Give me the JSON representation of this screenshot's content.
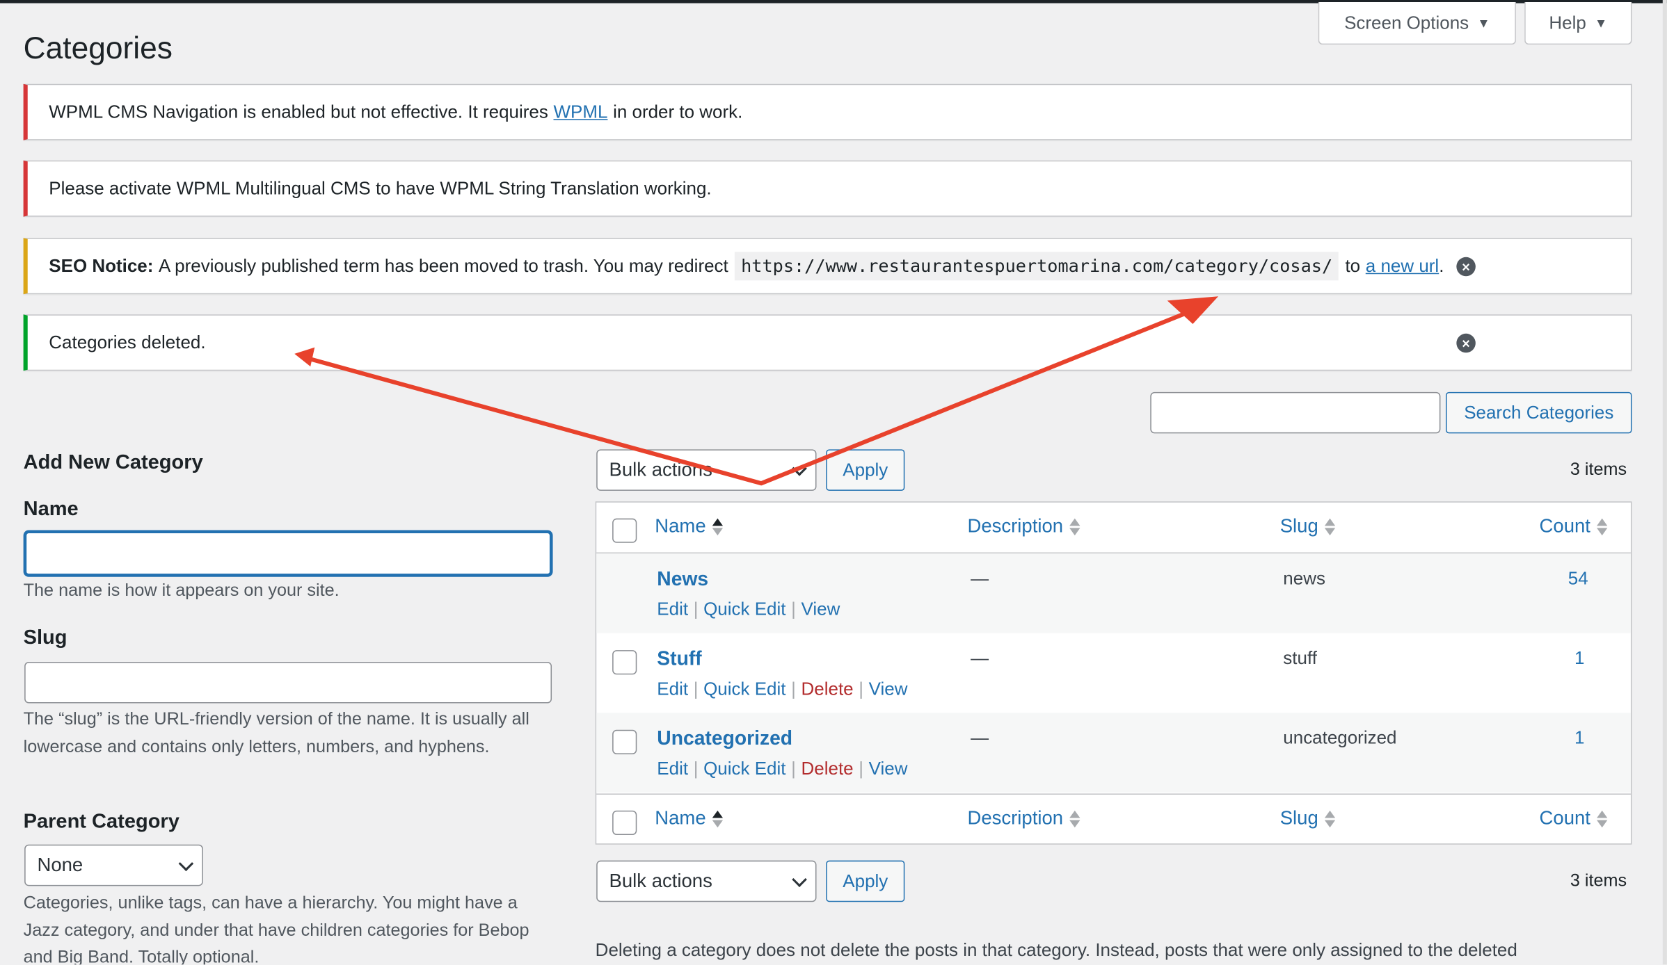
{
  "screen_meta": {
    "screen_options_label": "Screen Options",
    "help_label": "Help"
  },
  "page_title": "Categories",
  "notices": {
    "wpml_nav": {
      "text_before": "WPML CMS Navigation is enabled but not effective. It requires",
      "link": "WPML",
      "text_after": "in order to work."
    },
    "wpml_string": {
      "text": "Please activate WPML Multilingual CMS to have WPML String Translation working."
    },
    "seo": {
      "label": "SEO Notice:",
      "text": "A previously published term has been moved to trash. You may redirect",
      "url": "https://www.restaurantespuertomarina.com/category/cosas/",
      "text_to": "to",
      "link": "a new url",
      "period": "."
    },
    "success": {
      "text": "Categories deleted."
    }
  },
  "search": {
    "placeholder": "",
    "button_label": "Search Categories"
  },
  "add_form": {
    "title": "Add New Category",
    "name_label": "Name",
    "name_help": "The name is how it appears on your site.",
    "slug_label": "Slug",
    "slug_help": "The “slug” is the URL-friendly version of the name. It is usually all lowercase and contains only letters, numbers, and hyphens.",
    "parent_label": "Parent Category",
    "parent_value": "None",
    "parent_help": "Categories, unlike tags, can have a hierarchy. You might have a Jazz category, and under that have children categories for Bebop and Big Band. Totally optional."
  },
  "tablenav": {
    "bulk_label": "Bulk actions",
    "apply_label": "Apply",
    "items_count": "3 items"
  },
  "table": {
    "columns": {
      "name": "Name",
      "description": "Description",
      "slug": "Slug",
      "count": "Count"
    },
    "rows": [
      {
        "name": "News",
        "description": "—",
        "slug": "news",
        "count": "54",
        "actions": [
          "Edit",
          "Quick Edit",
          "View"
        ]
      },
      {
        "name": "Stuff",
        "description": "—",
        "slug": "stuff",
        "count": "1",
        "actions": [
          "Edit",
          "Quick Edit",
          "Delete",
          "View"
        ]
      },
      {
        "name": "Uncategorized",
        "description": "—",
        "slug": "uncategorized",
        "count": "1",
        "actions": [
          "Edit",
          "Quick Edit",
          "Delete",
          "View"
        ]
      }
    ]
  },
  "footer_note": "Deleting a category does not delete the posts in that category. Instead, posts that were only assigned to the deleted",
  "colors": {
    "accent": "#2271b1",
    "error": "#d63638",
    "warning": "#dba617",
    "success": "#00a32a",
    "delete": "#b32d2e",
    "annotation": "#e8422c"
  }
}
